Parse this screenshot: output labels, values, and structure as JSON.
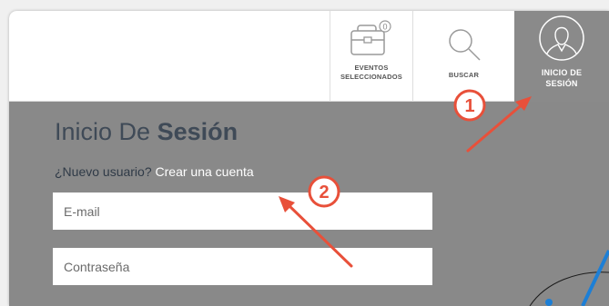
{
  "header": {
    "nav": {
      "events_label": "EVENTOS SELECCIONADOS",
      "events_badge": "0",
      "search_label": "BUSCAR",
      "login_label": "INICIO DE SESIÓN"
    }
  },
  "login": {
    "title_light": "Inicio De ",
    "title_bold": "Sesión",
    "new_user_question": "¿Nuevo usuario?",
    "create_account_link": "Crear una cuenta",
    "email_placeholder": "E-mail",
    "password_placeholder": "Contraseña"
  },
  "annotations": {
    "callout_1": "1",
    "callout_2": "2",
    "arrow_color": "#e8503a"
  },
  "colors": {
    "panel_bg": "#898989",
    "header_bg": "#ffffff",
    "login_nav_bg": "#8a8a8a",
    "title_color": "#3f4a57"
  }
}
